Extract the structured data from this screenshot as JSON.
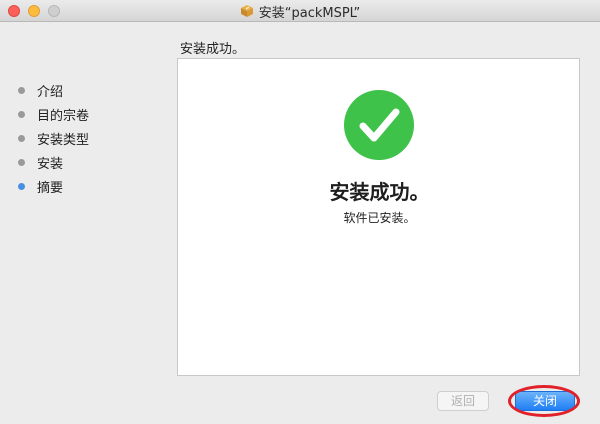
{
  "window": {
    "title": "安装“packMSPL”"
  },
  "heading": "安装成功。",
  "sidebar": {
    "steps": [
      {
        "label": "介绍",
        "active": false
      },
      {
        "label": "目的宗卷",
        "active": false
      },
      {
        "label": "安装类型",
        "active": false
      },
      {
        "label": "安装",
        "active": false
      },
      {
        "label": "摘要",
        "active": true
      }
    ]
  },
  "main": {
    "success_icon": "checkmark-circle-icon",
    "success_title": "安装成功。",
    "success_message": "软件已安装。"
  },
  "buttons": {
    "back_label": "返回",
    "close_label": "关闭"
  },
  "colors": {
    "accent": "#4a90e2",
    "success_green": "#3fc24a",
    "highlight": "#e0212a",
    "button_blue": "#1f7ff4"
  }
}
